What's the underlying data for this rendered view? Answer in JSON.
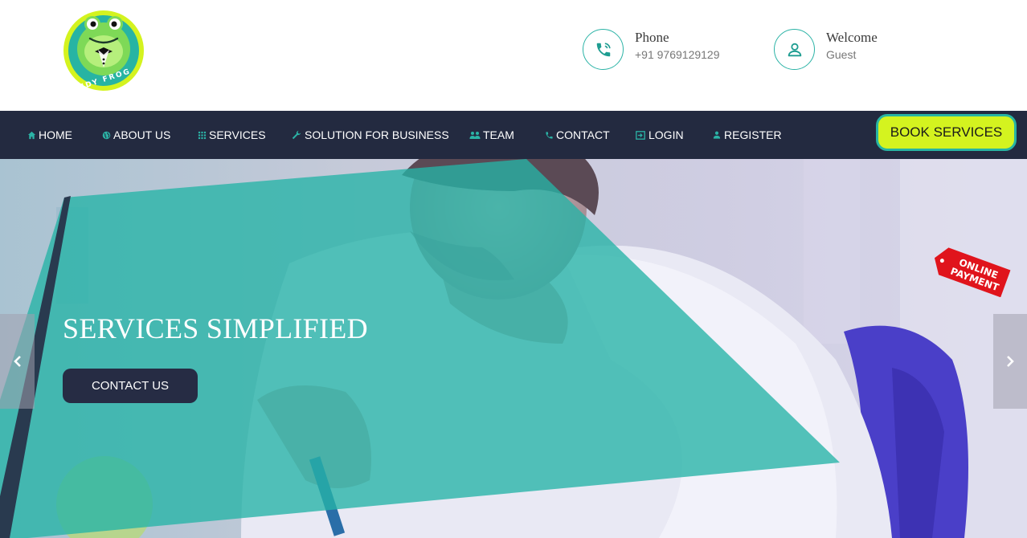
{
  "header": {
    "logo_text": "TIDY FROG",
    "phone": {
      "label": "Phone",
      "value": "+91 9769129129",
      "icon": "phone-icon"
    },
    "welcome": {
      "label": "Welcome",
      "value": "Guest",
      "icon": "user-icon"
    }
  },
  "nav": {
    "items": [
      {
        "label": "HOME",
        "icon": "home-icon"
      },
      {
        "label": "ABOUT US",
        "icon": "globe-icon"
      },
      {
        "label": "SERVICES",
        "icon": "grid-icon"
      },
      {
        "label": "SOLUTION FOR BUSINESS",
        "icon": "wrench-icon"
      },
      {
        "label": "TEAM",
        "icon": "team-icon"
      },
      {
        "label": "CONTACT",
        "icon": "phone-icon"
      },
      {
        "label": "LOGIN",
        "icon": "login-icon"
      },
      {
        "label": "REGISTER",
        "icon": "user-icon"
      }
    ],
    "book_button": "BOOK SERVICES"
  },
  "hero": {
    "title": "SERVICES SIMPLIFIED",
    "cta": "CONTACT US",
    "badge": {
      "line1": "ONLINE",
      "line2": "PAYMENT"
    }
  },
  "colors": {
    "navbar": "#232a40",
    "accent_teal": "#2bb3a6",
    "accent_lime": "#d4f31f",
    "badge_red": "#e0141c"
  }
}
